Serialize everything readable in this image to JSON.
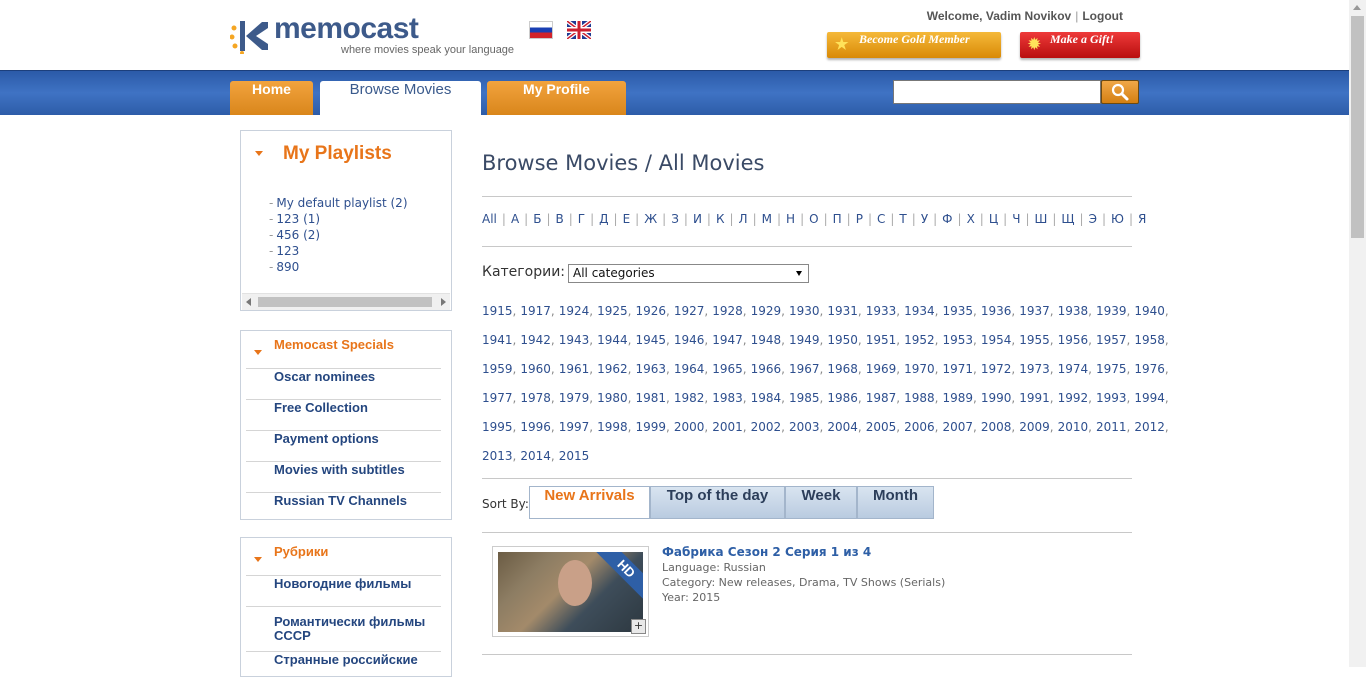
{
  "header": {
    "logo_name": "memocast",
    "logo_tagline": "where movies speak your language",
    "welcome_text": "Welcome, Vadim Novikov",
    "logout_label": "Logout",
    "gold_member_label": "Become Gold Member",
    "gift_label": "Make a Gift!"
  },
  "nav": {
    "tabs": [
      {
        "label": "Home"
      },
      {
        "label": "Browse Movies"
      },
      {
        "label": "My Profile"
      }
    ],
    "active_tab": "Browse Movies",
    "search_value": ""
  },
  "sidebar": {
    "playlists_title": "My Playlists",
    "playlists": [
      "My default playlist (2)",
      "123 (1)",
      "456 (2)",
      "123",
      "890"
    ],
    "specials_title": "Memocast Specials",
    "specials": [
      "Oscar nominees",
      "Free Collection",
      "Payment options",
      "Movies with subtitles",
      "Russian TV Channels"
    ],
    "rubriki_title": "Рубрики",
    "rubriki": [
      "Новогодние фильмы",
      "Романтически фильмы СССР",
      "Странные российские"
    ]
  },
  "main": {
    "page_title": "Browse Movies / All Movies",
    "alphabet": [
      "All",
      "А",
      "Б",
      "В",
      "Г",
      "Д",
      "Е",
      "Ж",
      "З",
      "И",
      "К",
      "Л",
      "М",
      "Н",
      "О",
      "П",
      "Р",
      "С",
      "Т",
      "У",
      "Ф",
      "Х",
      "Ц",
      "Ч",
      "Ш",
      "Щ",
      "Э",
      "Ю",
      "Я"
    ],
    "category_label": "Категории:",
    "category_value": "All categories",
    "year_rows": [
      [
        "1915",
        "1917",
        "1924",
        "1925",
        "1926",
        "1927",
        "1928",
        "1929",
        "1930",
        "1931",
        "1933",
        "1934",
        "1935",
        "1936",
        "1937",
        "1938",
        "1939",
        "1940"
      ],
      [
        "1941",
        "1942",
        "1943",
        "1944",
        "1945",
        "1946",
        "1947",
        "1948",
        "1949",
        "1950",
        "1951",
        "1952",
        "1953",
        "1954",
        "1955",
        "1956",
        "1957",
        "1958"
      ],
      [
        "1959",
        "1960",
        "1961",
        "1962",
        "1963",
        "1964",
        "1965",
        "1966",
        "1967",
        "1968",
        "1969",
        "1970",
        "1971",
        "1972",
        "1973",
        "1974",
        "1975",
        "1976"
      ],
      [
        "1977",
        "1978",
        "1979",
        "1980",
        "1981",
        "1982",
        "1983",
        "1984",
        "1985",
        "1986",
        "1987",
        "1988",
        "1989",
        "1990",
        "1991",
        "1992",
        "1993",
        "1994"
      ],
      [
        "1995",
        "1996",
        "1997",
        "1998",
        "1999",
        "2000",
        "2001",
        "2002",
        "2003",
        "2004",
        "2005",
        "2006",
        "2007",
        "2008",
        "2009",
        "2010",
        "2011",
        "2012"
      ],
      [
        "2013",
        "2014",
        "2015"
      ]
    ],
    "sort_label": "Sort By:",
    "sort_options": [
      "New Arrivals",
      "Top of the day",
      "Week",
      "Month"
    ],
    "active_sort": "New Arrivals",
    "movie": {
      "title": "Фабрика Сезон 2 Серия 1 из 4",
      "language": "Language: Russian",
      "category": "Category: New releases, Drama, TV Shows (Serials)",
      "year": "Year: 2015",
      "badge": "HD",
      "add_symbol": "+"
    }
  },
  "colors": {
    "accent_orange": "#e8751a",
    "nav_blue": "#3f73c4",
    "link_blue": "#2e4f8e"
  }
}
